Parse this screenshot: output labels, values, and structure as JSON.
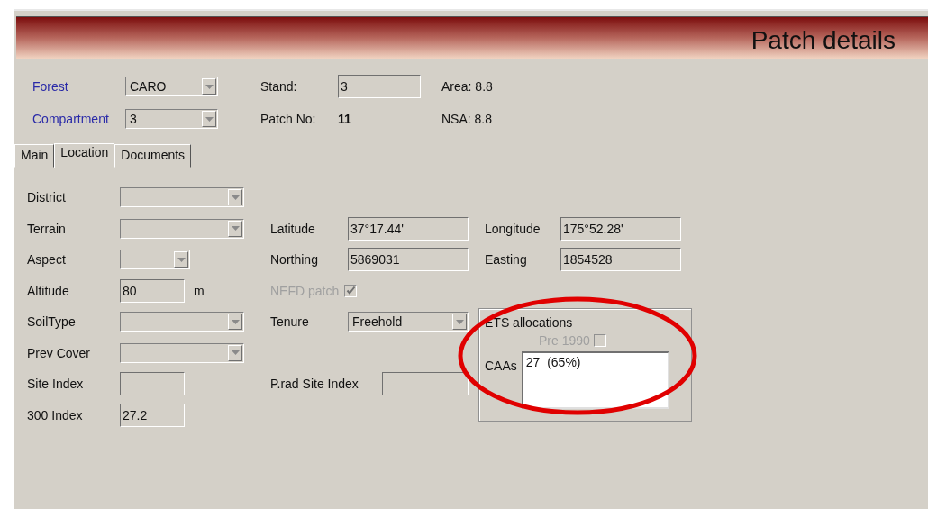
{
  "header": {
    "title": "Patch details"
  },
  "top_fields": [
    {
      "label": "Forest",
      "kind": "combo",
      "link": true,
      "value": "CARO"
    },
    {
      "label": "Compartment",
      "kind": "combo",
      "link": true,
      "value": "3"
    },
    {
      "label": "Stand:",
      "kind": "text",
      "link": false,
      "value": "3"
    },
    {
      "label": "Patch No:",
      "kind": "bold",
      "link": false,
      "value": "11"
    },
    {
      "label": "Area: 8.8",
      "kind": "plain",
      "link": false
    },
    {
      "label": "NSA: 8.8",
      "kind": "plain",
      "link": false
    }
  ],
  "tabs": [
    {
      "label": "Main",
      "selected": false
    },
    {
      "label": "Location",
      "selected": true
    },
    {
      "label": "Documents",
      "selected": false
    }
  ],
  "left_fields": [
    {
      "label": "District",
      "kind": "combo"
    },
    {
      "label": "Terrain",
      "kind": "combo"
    },
    {
      "label": "Aspect",
      "kind": "combo_small"
    },
    {
      "label": "Altitude",
      "kind": "text",
      "value": "80",
      "unit": "m"
    },
    {
      "label": "SoilType",
      "kind": "combo"
    },
    {
      "label": "Prev Cover",
      "kind": "combo"
    },
    {
      "label": "Site Index",
      "kind": "text"
    },
    {
      "label": "300 Index",
      "kind": "text",
      "value": "27.2"
    }
  ],
  "middle_fields": [
    {
      "label": "Latitude",
      "kind": "text",
      "value": "37°17.44'"
    },
    {
      "label": "Northing",
      "kind": "text",
      "value": "5869031"
    },
    {
      "label": "NEFD patch",
      "kind": "checkbox",
      "checked": true,
      "disabled": true
    },
    {
      "label": "Tenure",
      "kind": "combo",
      "value": "Freehold"
    },
    {
      "label": "P.rad Site Index",
      "kind": "text_short"
    }
  ],
  "right_fields": [
    {
      "label": "Longitude",
      "kind": "text",
      "value": "175°52.28'"
    },
    {
      "label": "Easting",
      "kind": "text",
      "value": "1854528"
    }
  ],
  "ets": {
    "title": "ETS allocations",
    "pre_1990": {
      "label": "Pre 1990",
      "checked": false,
      "disabled": true
    },
    "caas": {
      "label": "CAAs",
      "value": "27  (65%)"
    }
  },
  "annotation": {
    "kind": "ellipse"
  }
}
